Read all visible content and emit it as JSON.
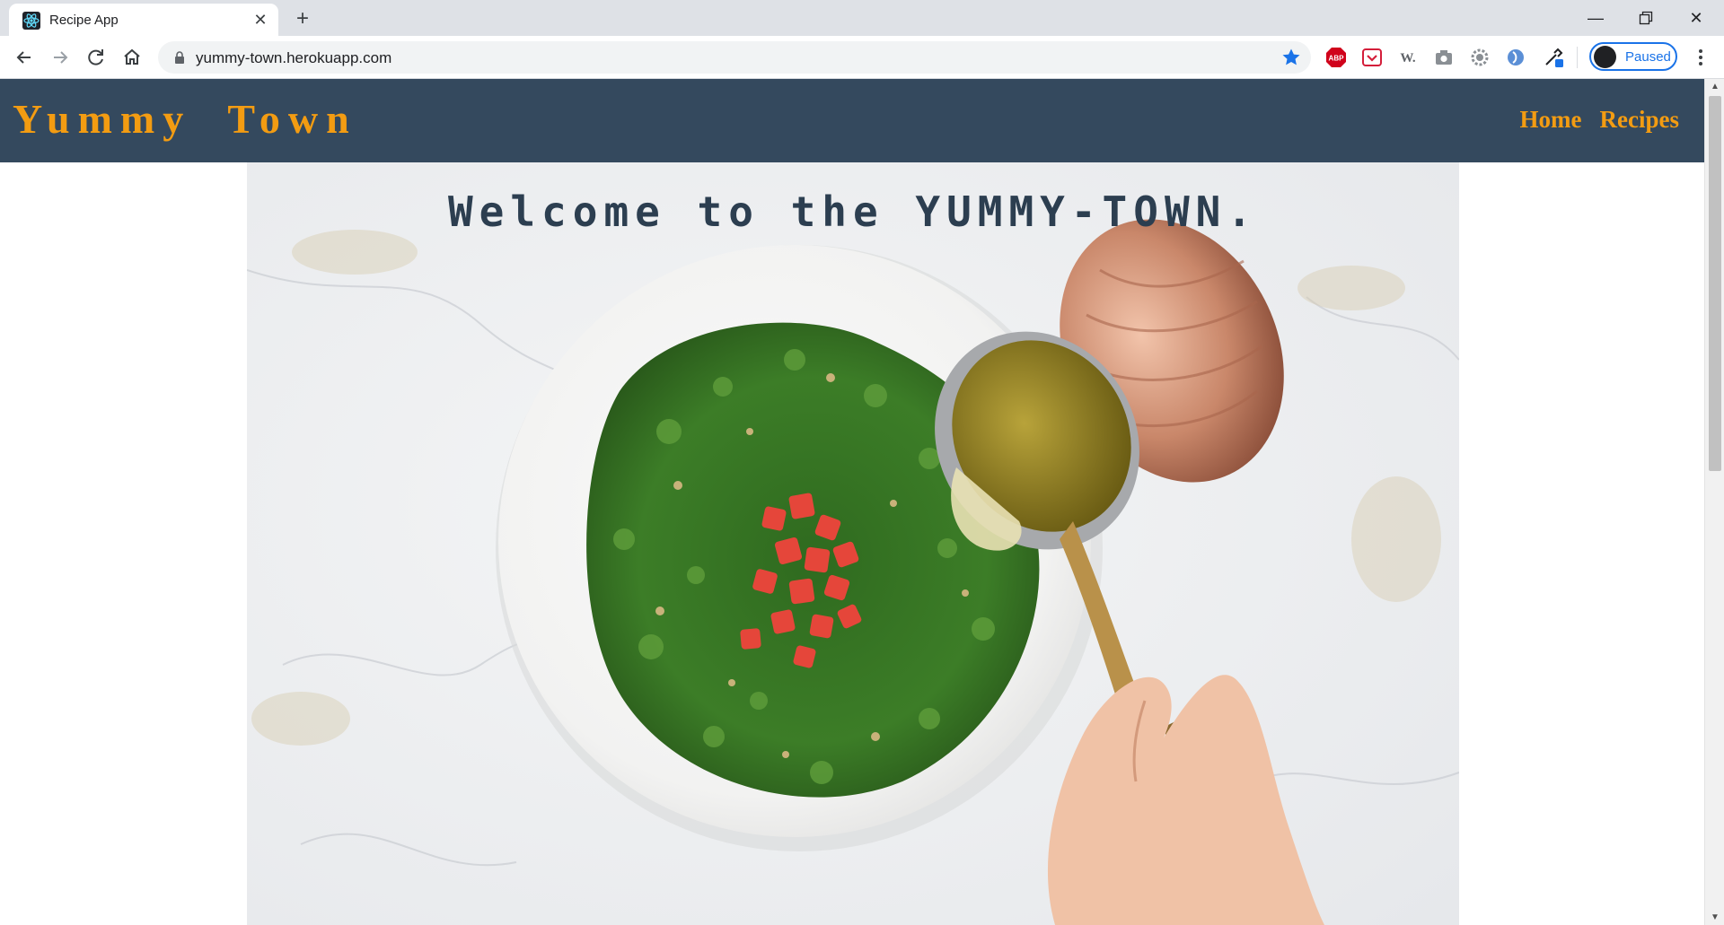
{
  "browser": {
    "tab_title": "Recipe App",
    "url": "yummy-town.herokuapp.com",
    "profile_label": "Paused",
    "extensions": [
      "adblock-icon",
      "pocket-icon",
      "wikipedia-icon",
      "camera-icon",
      "gear-extension-icon",
      "circle-extension-icon",
      "eyedropper-extension-icon"
    ],
    "extension_wiki_text": "W.",
    "extension_abp_text": "ABP"
  },
  "site": {
    "brand": "Yummy  Town",
    "nav": {
      "home": "Home",
      "recipes": "Recipes"
    },
    "hero_title": "Welcome to the YUMMY-TOWN."
  },
  "colors": {
    "nav_bg": "#34495e",
    "accent": "#f39c12",
    "hero_title": "#2c3e50",
    "chrome_accent": "#1a73e8"
  }
}
